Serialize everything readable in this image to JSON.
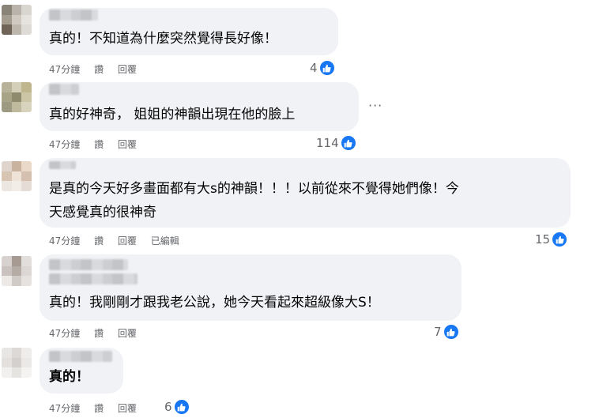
{
  "comments": [
    {
      "text": "真的！不知道為什麼突然覺得長好像！",
      "time": "47分鐘",
      "like": "讚",
      "reply": "回覆",
      "edited": "",
      "reactions": "4"
    },
    {
      "text": "真的好神奇， 姐姐的神韻出現在他的臉上",
      "time": "47分鐘",
      "like": "讚",
      "reply": "回覆",
      "edited": "",
      "reactions": "114"
    },
    {
      "text": "是真的今天好多畫面都有大s的神韻！！！以前從來不覺得她們像！今\n天感覺真的很神奇",
      "time": "47分鐘",
      "like": "讚",
      "reply": "回覆",
      "edited": "已編輯",
      "reactions": "15"
    },
    {
      "text": "真的！我剛剛才跟我老公說，她今天看起來超級像大S！",
      "time": "47分鐘",
      "like": "讚",
      "reply": "回覆",
      "edited": "",
      "reactions": "7"
    },
    {
      "text": "真的！",
      "time": "47分鐘",
      "like": "讚",
      "reply": "回覆",
      "edited": "",
      "reactions": "6"
    }
  ],
  "icons": {
    "like": "thumbs-up-icon",
    "more": "more-options-icon"
  },
  "colors": {
    "like_blue": "#1877f2",
    "bubble": "#f0f2f5",
    "meta_gray": "#65676b"
  }
}
